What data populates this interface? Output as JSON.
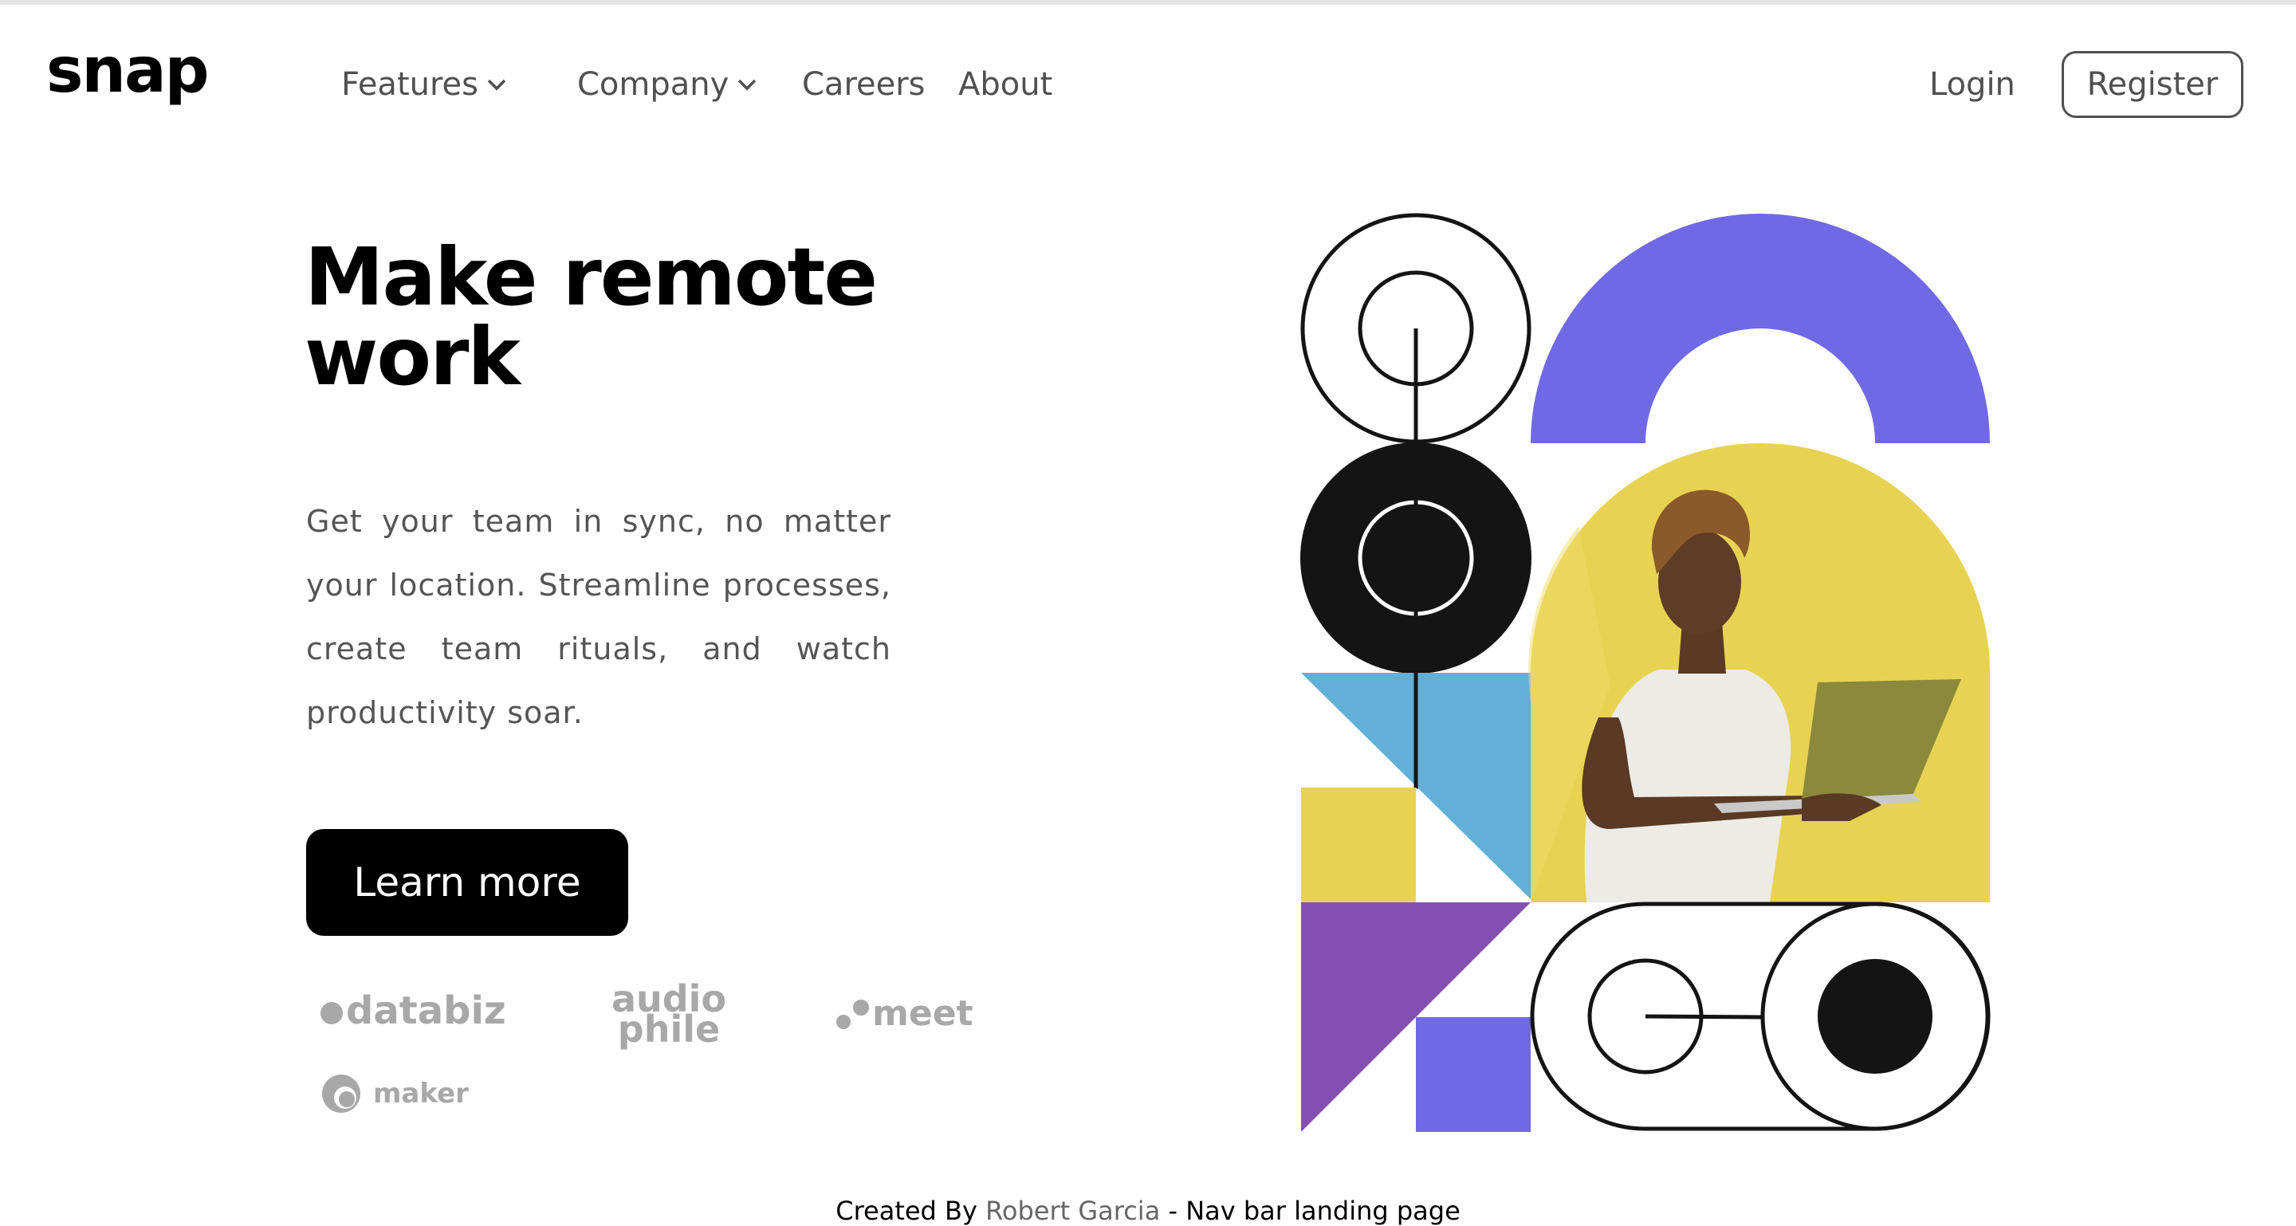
{
  "brand": {
    "name": "snap"
  },
  "nav": {
    "features": "Features",
    "company": "Company",
    "careers": "Careers",
    "about": "About",
    "login": "Login",
    "register": "Register"
  },
  "hero": {
    "headline": "Make remote work",
    "body": "Get your team in sync, no matter your location. Streamline processes, create team rituals, and watch productivity soar.",
    "cta": "Learn more"
  },
  "clients": {
    "databiz": "databiz",
    "audiophile_top": "audio",
    "audiophile_bottom": "phile",
    "meet": "meet",
    "maker": "maker"
  },
  "footer": {
    "prefix": "Created By ",
    "author": "Robert Garcia",
    "suffix": " - Nav bar landing page"
  },
  "colors": {
    "purple": "#7069e6",
    "yellow": "#e8d252",
    "blue": "#62b0d8",
    "violet": "#8550b1",
    "dark": "#141414"
  }
}
